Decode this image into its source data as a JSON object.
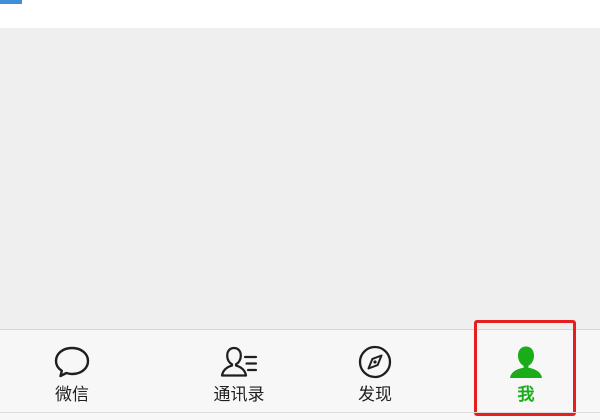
{
  "tabs": [
    {
      "key": "weixin",
      "label": "微信",
      "icon": "chat-bubble-icon",
      "active": false
    },
    {
      "key": "contacts",
      "label": "通讯录",
      "icon": "contacts-icon",
      "active": false
    },
    {
      "key": "discover",
      "label": "发现",
      "icon": "compass-icon",
      "active": false
    },
    {
      "key": "me",
      "label": "我",
      "icon": "person-icon",
      "active": true
    }
  ],
  "colors": {
    "active": "#1aad19",
    "inactive": "#1f1f1f",
    "highlight": "#e61e1e",
    "content_bg": "#efefef",
    "tabbar_bg": "#f7f7f7"
  }
}
